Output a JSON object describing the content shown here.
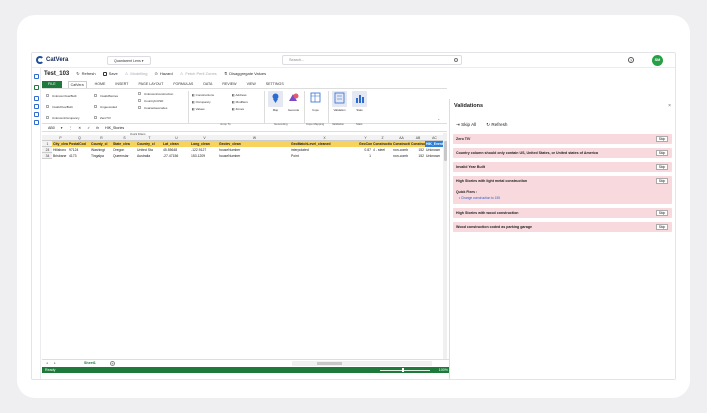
{
  "app": {
    "name": "CatVera",
    "model_selector": "Quantarent Lens",
    "search_placeholder": "Search...",
    "user_initials": "SM"
  },
  "doc": {
    "name": "Test_103",
    "toolbar": {
      "refresh": "Refresh",
      "save": "Save",
      "modelling": "Modelling",
      "hazard": "Hazard",
      "fetch": "Fetch Peril Zones",
      "disaggregate": "Disaggregate Values"
    }
  },
  "ribbon": {
    "tabs": [
      "FILE",
      "CatVera",
      "HOME",
      "INSERT",
      "PAGE LAYOUT",
      "FORMULAS",
      "DATA",
      "REVIEW",
      "VIEW",
      "SETTINGS"
    ],
    "active_tab": "CatVera",
    "checks_col1": [
      "UnknownYearBuilt",
      "InvalidYearBuilt",
      "UnknownOccupancy"
    ],
    "checks_col2": [
      "InvalidStories",
      "Ungeocoded",
      "ZeroTIV"
    ],
    "checks_col3": [
      "UnknownConstruction",
      "CountryInUSD",
      "CoarseGeocodes"
    ],
    "jump_links": [
      "Constructions",
      "Occupancy",
      "Values",
      "Address",
      "Modifiers",
      "Zones"
    ],
    "groups": {
      "jump_to": "Jump To",
      "geocoding": "Geocoding",
      "cope_mapping": "Cope Mapping",
      "validation": "Validation",
      "stats": "Stats"
    },
    "buttons": {
      "map": "Map",
      "geocode": "Geocode",
      "cope": "Cope",
      "validation": "Validation",
      "stats": "Stats"
    }
  },
  "formula_bar": {
    "name_box": "AB0",
    "formula": "HIK_Stories",
    "quick_filters": "Quick Filters"
  },
  "sheet": {
    "columns": [
      "P",
      "Q",
      "R",
      "S",
      "T",
      "U",
      "V",
      "W",
      "X",
      "Y",
      "Z",
      "AA",
      "AB",
      "AC"
    ],
    "header_row": [
      "City_clean",
      "PostalCod",
      "County_cl",
      "State_clea",
      "Country_cl",
      "Lat_clean",
      "Long_clean",
      "Geolev_clean",
      "GeoMatchLevel_cleaned",
      "GeoConfid",
      "ConstructionUsage",
      "ConstructionCodes",
      "Construct",
      "HIK_Event"
    ],
    "rows": [
      {
        "num": "24",
        "cells": [
          "Hillsboro",
          "97124",
          "Washingt",
          "Oregon",
          "United Sta",
          "45.55648",
          "-122.9127",
          "houseNumber",
          "interpolated",
          "0.87",
          "4 - steel",
          "non-comb",
          "152",
          "Unknown"
        ]
      },
      {
        "num": "34",
        "cells": [
          "Brisbane",
          "4173",
          "Tingalpa",
          "Queenslar",
          "Australia",
          "-27.47156",
          "153.1209",
          "houseNumber",
          "Point",
          "1",
          "",
          "non-comb",
          "152",
          "Unknown"
        ]
      }
    ],
    "tab": "Sheet1",
    "status": "Ready",
    "zoom": "100%"
  },
  "validations": {
    "title": "Validations",
    "skip_all": "Skip All",
    "refresh": "Refresh",
    "skip_label": "Skip",
    "quick_fixes_label": "Quick Fixes :",
    "items": [
      {
        "text": "Zero TIV"
      },
      {
        "text": "Country column should only contain US, United States, or United states of America"
      },
      {
        "text": "Invalid Year Built"
      },
      {
        "text": "High Stories with light metal construction",
        "quick_fix": "Change construction to 155"
      },
      {
        "text": "High Stories with wood construction"
      },
      {
        "text": "Wood construction coded as parking garage"
      }
    ]
  }
}
